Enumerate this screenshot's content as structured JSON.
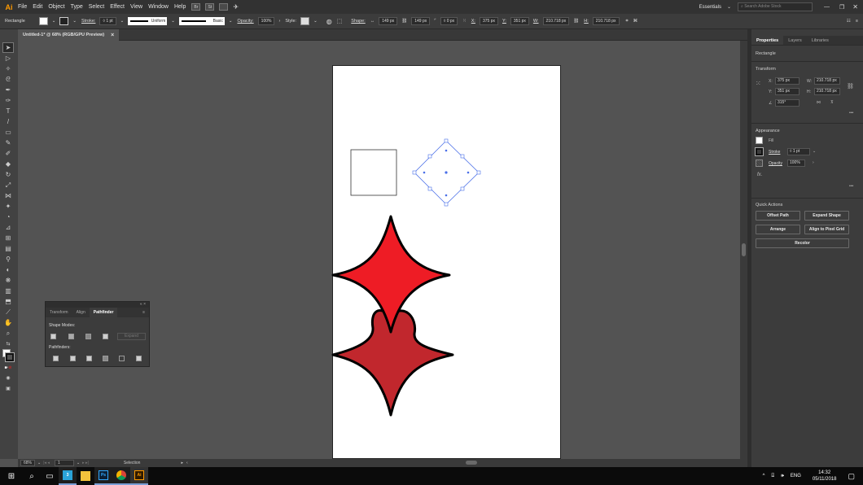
{
  "app": {
    "logo": "Ai",
    "menu": [
      "File",
      "Edit",
      "Object",
      "Type",
      "Select",
      "Effect",
      "View",
      "Window",
      "Help"
    ],
    "bridge_icon": "Br",
    "stock_icon": "St",
    "workspace": "Essentials",
    "search_placeholder": "Search Adobe Stock"
  },
  "options": {
    "object_type": "Rectangle",
    "stroke_label": "Stroke:",
    "stroke_value": "1 pt",
    "profile_uniform": "Uniform",
    "brush_basic": "Basic",
    "opacity_label": "Opacity:",
    "opacity_value": "100%",
    "style_label": "Style:",
    "shape_label": "Shape:",
    "shape_w": "149 px",
    "shape_h": "149 px",
    "corner": "0 px",
    "x_label": "X:",
    "x_value": "375 px",
    "y_label": "Y:",
    "y_value": "351 px",
    "w_label": "W:",
    "w_value": "210.718 px",
    "h_label": "H:",
    "h_value": "210.718 px"
  },
  "document": {
    "tab_title": "Untitled-1* @ 68% (RGB/GPU Preview)",
    "close": "×"
  },
  "status": {
    "zoom": "68%",
    "page": "1",
    "tool_name": "Selection"
  },
  "properties_panel": {
    "tabs": [
      "Properties",
      "Layers",
      "Libraries"
    ],
    "selection_type": "Rectangle",
    "transform_header": "Transform",
    "x_label": "X:",
    "x_value": "375 px",
    "y_label": "Y:",
    "y_value": "351 px",
    "w_label": "W:",
    "w_value": "210.718 px",
    "h_label": "H:",
    "h_value": "210.718 px",
    "angle_value": "315°",
    "appearance_header": "Appearance",
    "fill_label": "Fill",
    "stroke_label": "Stroke",
    "stroke_value": "1 pt",
    "opacity_label": "Opacity",
    "opacity_value": "100%",
    "fx_label": "fx.",
    "quick_actions_header": "Quick Actions",
    "btn_offset_path": "Offset Path",
    "btn_expand_shape": "Expand Shape",
    "btn_arrange": "Arrange",
    "btn_align_pixel": "Align to Pixel Grid",
    "btn_recolor": "Recolor"
  },
  "pathfinder_panel": {
    "tabs": [
      "Transform",
      "Align",
      "Pathfinder"
    ],
    "shape_modes_label": "Shape Modes:",
    "pathfinders_label": "Pathfinders:",
    "expand_label": "Expand",
    "collapse": "«  ×"
  },
  "taskbar": {
    "lang": "ENG",
    "time": "14:32",
    "date": "05/11/2018",
    "ps_label": "Ps",
    "ai_label": "Ai"
  },
  "colors": {
    "accent_red": "#ee1c25",
    "dark_red": "#c1272d",
    "selection_blue": "#4a6fe8",
    "ai_orange": "#ff9a00"
  }
}
